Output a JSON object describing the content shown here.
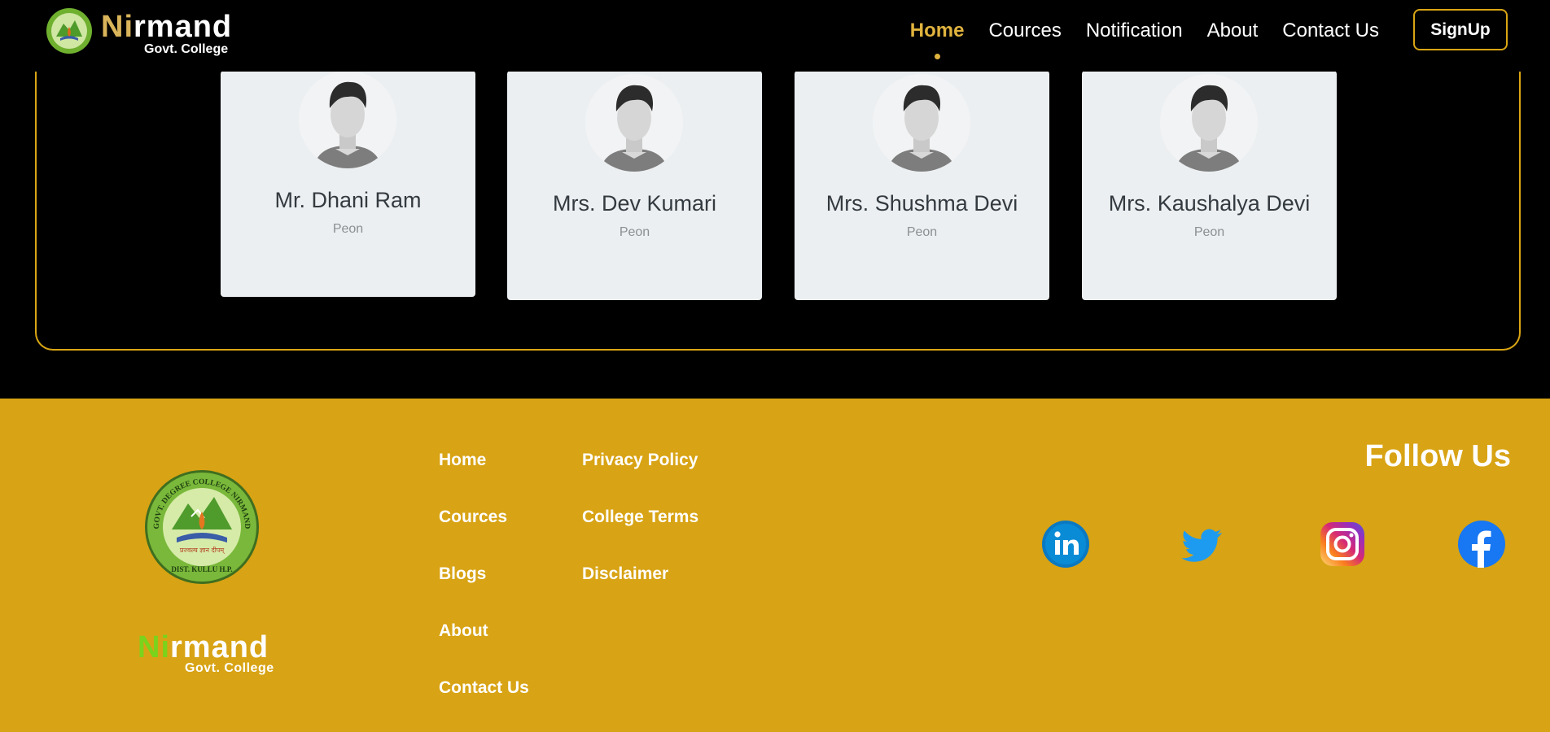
{
  "header": {
    "brand_ni": "Ni",
    "brand_rest": "rmand",
    "brand_sub": "Govt. College",
    "nav": [
      {
        "label": "Home",
        "active": true
      },
      {
        "label": "Cources",
        "active": false
      },
      {
        "label": "Notification",
        "active": false
      },
      {
        "label": "About",
        "active": false
      },
      {
        "label": "Contact Us",
        "active": false
      }
    ],
    "signup_label": "SignUp"
  },
  "staff": [
    {
      "name": "Mr. Dhani Ram",
      "role": "Peon"
    },
    {
      "name": "Mrs. Dev Kumari",
      "role": "Peon"
    },
    {
      "name": "Mrs. Shushma Devi",
      "role": "Peon"
    },
    {
      "name": "Mrs. Kaushalya Devi",
      "role": "Peon"
    }
  ],
  "footer": {
    "seal_text_top": "GOVT. DEGREE COLLEGE NIRMAND",
    "seal_text_bottom": "DIST. KULLU H.P.",
    "seal_motto": "प्रज्वल्य ज्ञान दीपम्",
    "brand_ni": "Ni",
    "brand_rest": "rmand",
    "brand_sub": "Govt. College",
    "links_col1": [
      "Home",
      "Cources",
      "Blogs",
      "About",
      "Contact Us"
    ],
    "links_col2": [
      "Privacy Policy",
      "College Terms",
      "Disclaimer"
    ],
    "follow_title": "Follow Us",
    "social": [
      "linkedin-icon",
      "twitter-icon",
      "instagram-icon",
      "facebook-icon"
    ]
  },
  "colors": {
    "accent_gold": "#d9a514",
    "footer_bg": "#d8a314",
    "nav_active": "#e0b33e",
    "brand_green": "#7ad31c"
  }
}
